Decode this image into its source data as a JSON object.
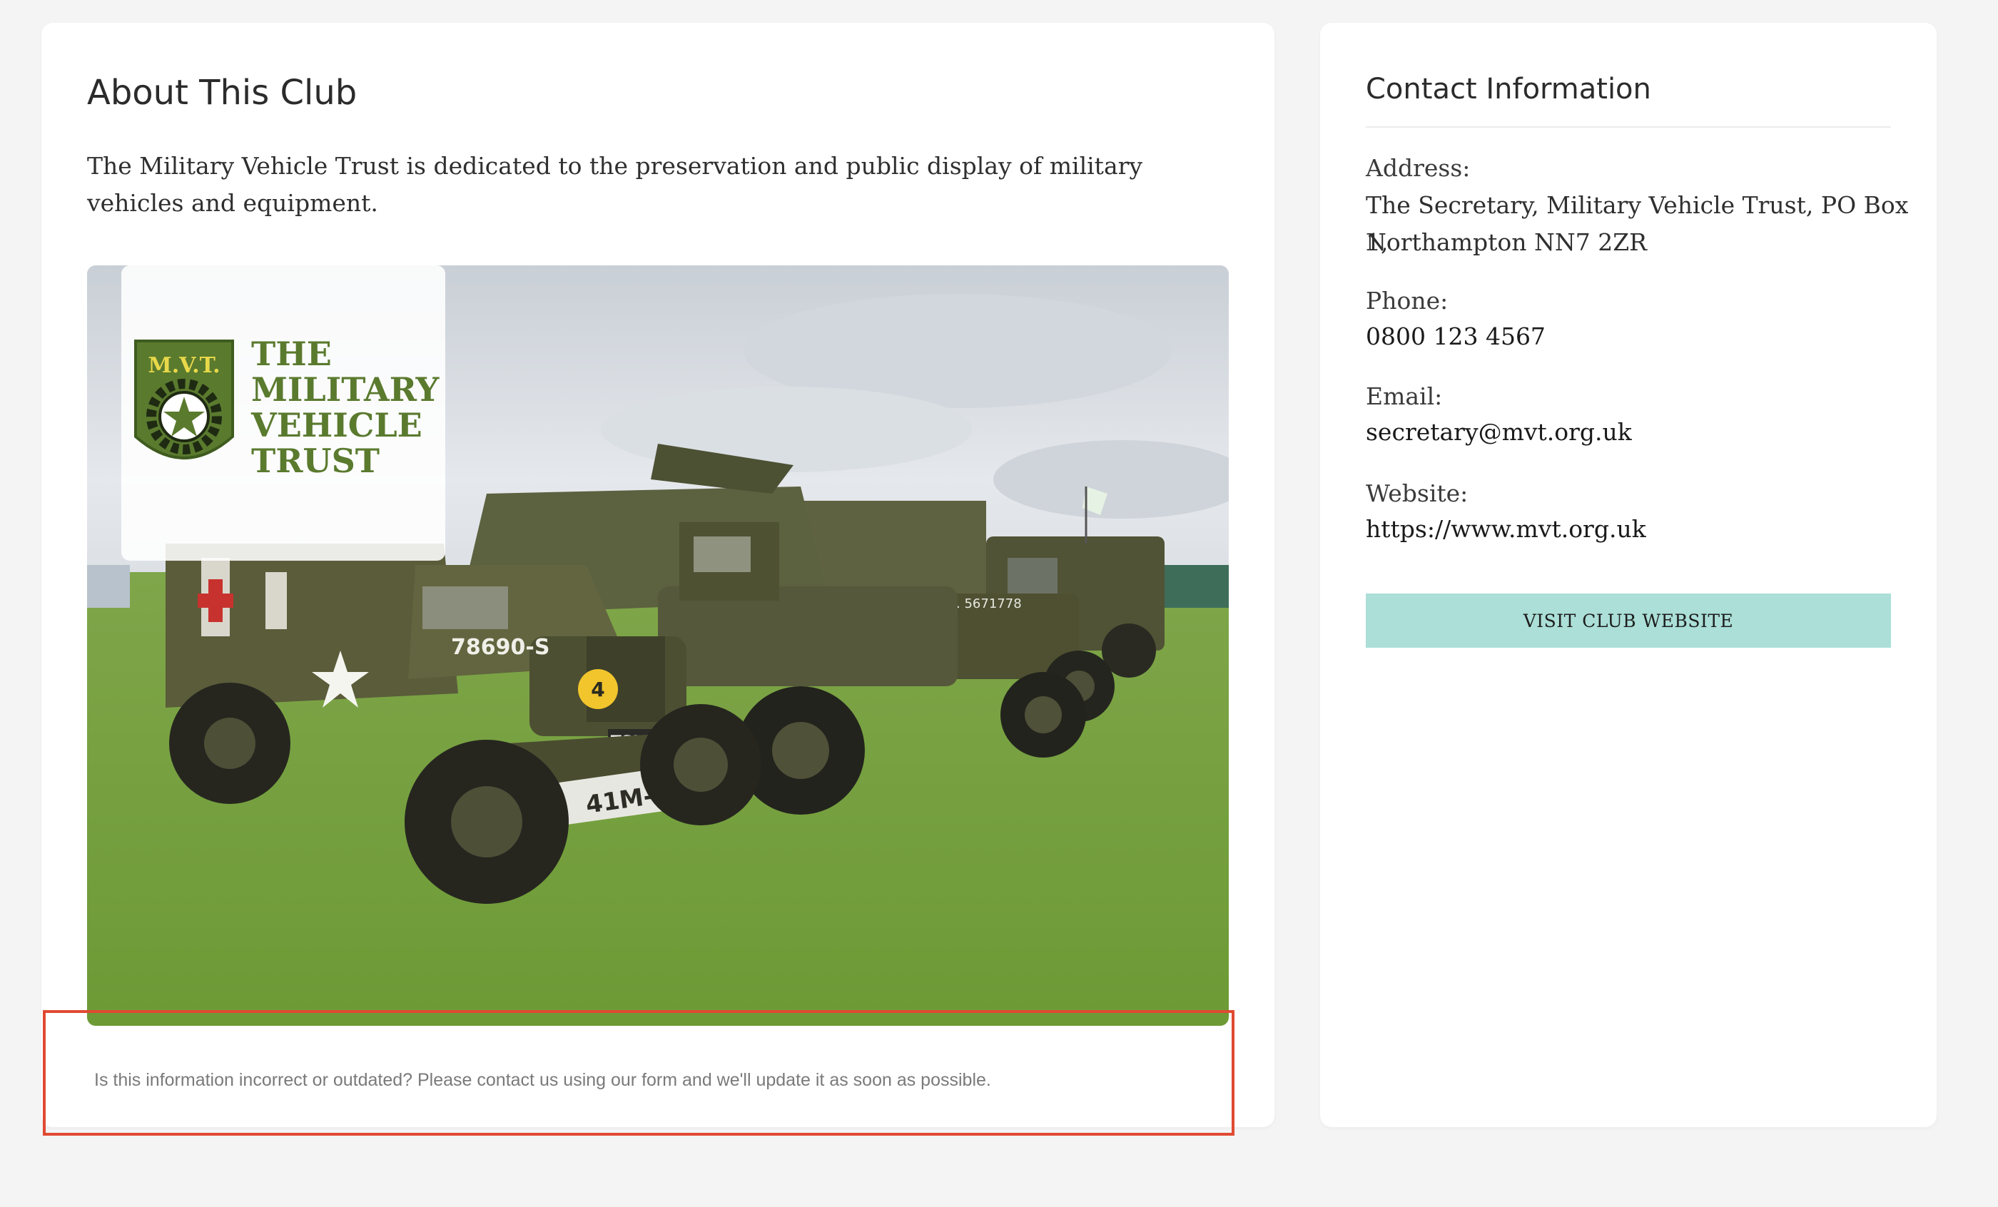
{
  "about": {
    "title": "About This Club",
    "description": "The Military Vehicle Trust is dedicated to the preservation and public display of military vehicles and equipment.",
    "logo": {
      "initials": "M.V.T.",
      "line1": "THE",
      "line2": "MILITARY",
      "line3": "VEHICLE",
      "line4": "TRUST"
    },
    "vehicle_markings": {
      "front_plate": "41M-EV",
      "rear_plate": "TSU 205",
      "bumper_number": "4",
      "hood_number": "78690-S",
      "truck_marking": "U.S.A. 5671778"
    }
  },
  "notice": {
    "text": "Is this information incorrect or outdated? Please contact us using our form and we'll update it as soon as possible."
  },
  "contact": {
    "title": "Contact Information",
    "address_label": "Address:",
    "address_line1": "The Secretary, Military Vehicle Trust, PO Box 1,",
    "address_line2": "Northampton NN7 2ZR",
    "phone_label": "Phone:",
    "phone": "0800 123 4567",
    "email_label": "Email:",
    "email": "secretary@mvt.org.uk",
    "website_label": "Website:",
    "website": "https://www.mvt.org.uk",
    "button_label": "VISIT CLUB WEBSITE"
  },
  "colors": {
    "page_bg": "#f4f4f4",
    "card_bg": "#ffffff",
    "button_bg": "#abdfd8",
    "highlight_border": "#e04a33",
    "olive_drab": "#4a4b2c",
    "logo_green": "#5a7a2e",
    "logo_yellow": "#e8d84a"
  }
}
